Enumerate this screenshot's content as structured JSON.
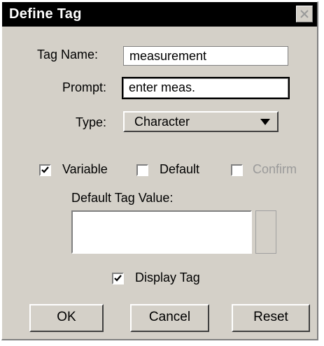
{
  "window": {
    "title": "Define Tag",
    "close_icon": "close-icon"
  },
  "form": {
    "tag_name": {
      "label": "Tag Name:",
      "value": "measurement"
    },
    "prompt": {
      "label": "Prompt:",
      "value": "enter meas."
    },
    "type": {
      "label": "Type:",
      "value": "Character"
    }
  },
  "options": {
    "variable": {
      "label": "Variable",
      "checked": true
    },
    "default": {
      "label": "Default",
      "checked": false
    },
    "confirm": {
      "label": "Confirm",
      "checked": false,
      "disabled": true
    }
  },
  "default_tag_value": {
    "label": "Default Tag Value:",
    "value": ""
  },
  "display_tag": {
    "label": "Display Tag",
    "checked": true
  },
  "buttons": {
    "ok": "OK",
    "cancel": "Cancel",
    "reset": "Reset"
  }
}
